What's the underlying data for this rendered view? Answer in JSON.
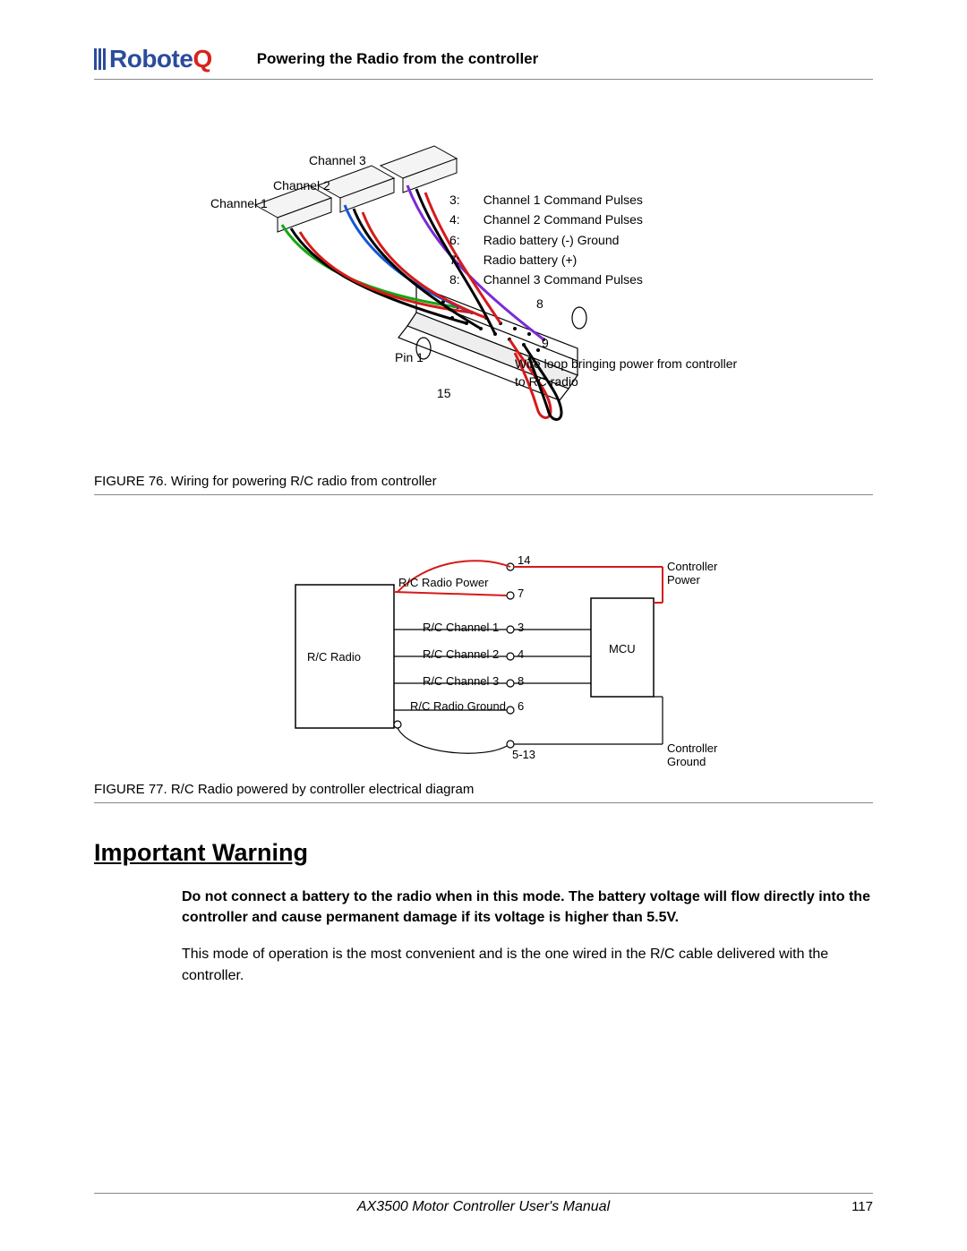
{
  "header": {
    "logo_text_left": "Robote",
    "logo_text_right": "Q",
    "section_title": "Powering the Radio from the controller"
  },
  "figure76": {
    "channel_labels": [
      "Channel 1",
      "Channel 2",
      "Channel 3"
    ],
    "pin_legend": [
      {
        "pin": "3:",
        "desc": "Channel 1 Command Pulses"
      },
      {
        "pin": "4:",
        "desc": "Channel 2 Command Pulses"
      },
      {
        "pin": "6:",
        "desc": "Radio battery (-) Ground"
      },
      {
        "pin": "7:",
        "desc": "Radio battery (+)"
      },
      {
        "pin": "8:",
        "desc": "Channel 3 Command Pulses"
      }
    ],
    "pin_markers": {
      "pin1": "Pin 1",
      "p8": "8",
      "p9": "9",
      "p15": "15"
    },
    "wire_loop_note": "Wire loop bringing power from controller to RC radio",
    "caption": "FIGURE 76.  Wiring for powering R/C radio from controller"
  },
  "figure77": {
    "left_block": "R/C Radio",
    "right_block": "MCU",
    "rows": [
      {
        "label": "R/C Radio Power",
        "pin_top": "14",
        "pin_mid": "7"
      },
      {
        "label": "R/C Channel 1",
        "pin": "3"
      },
      {
        "label": "R/C Channel 2",
        "pin": "4"
      },
      {
        "label": "R/C Channel 3",
        "pin": "8"
      },
      {
        "label": "R/C Radio Ground",
        "pin": "6"
      }
    ],
    "ground_pins": "5-13",
    "right_labels": {
      "power": "Controller\nPower",
      "ground": "Controller\nGround"
    },
    "caption": "FIGURE 77.  R/C Radio powered by controller electrical diagram"
  },
  "warning": {
    "heading": "Important Warning",
    "bold_text": "Do not connect a battery to the radio when in this mode. The battery voltage will flow directly into the controller and cause permanent damage if its voltage is higher than 5.5V.",
    "para2": "This mode of operation is the most convenient and is the one wired in the R/C cable delivered with the controller."
  },
  "footer": {
    "manual_title": "AX3500 Motor Controller User's Manual",
    "page_number": "117"
  }
}
